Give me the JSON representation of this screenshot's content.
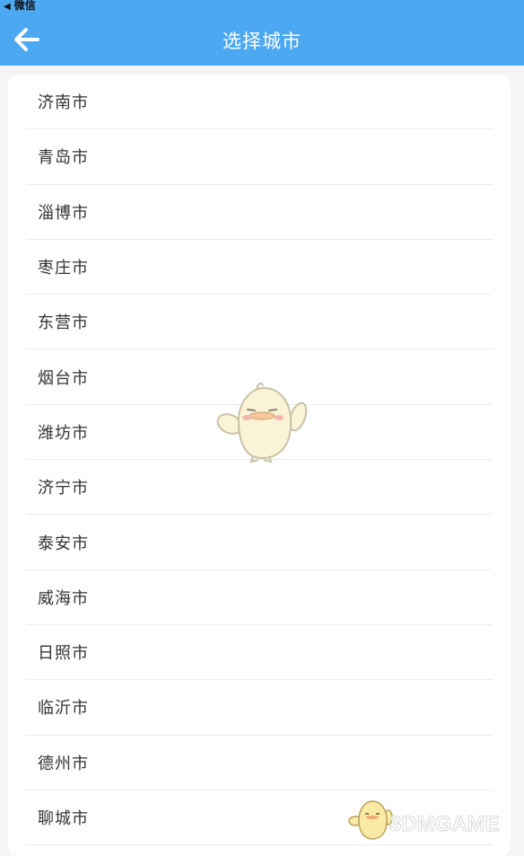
{
  "status_bar": {
    "back_app_label": "微信"
  },
  "header": {
    "title": "选择城市"
  },
  "cities": [
    "济南市",
    "青岛市",
    "淄博市",
    "枣庄市",
    "东营市",
    "烟台市",
    "潍坊市",
    "济宁市",
    "泰安市",
    "威海市",
    "日照市",
    "临沂市",
    "德州市",
    "聊城市"
  ],
  "watermark": {
    "text": "3DMGAME"
  },
  "colors": {
    "nav_bg": "#4da8f2",
    "page_bg": "#f4f5f7",
    "card_bg": "#ffffff"
  }
}
